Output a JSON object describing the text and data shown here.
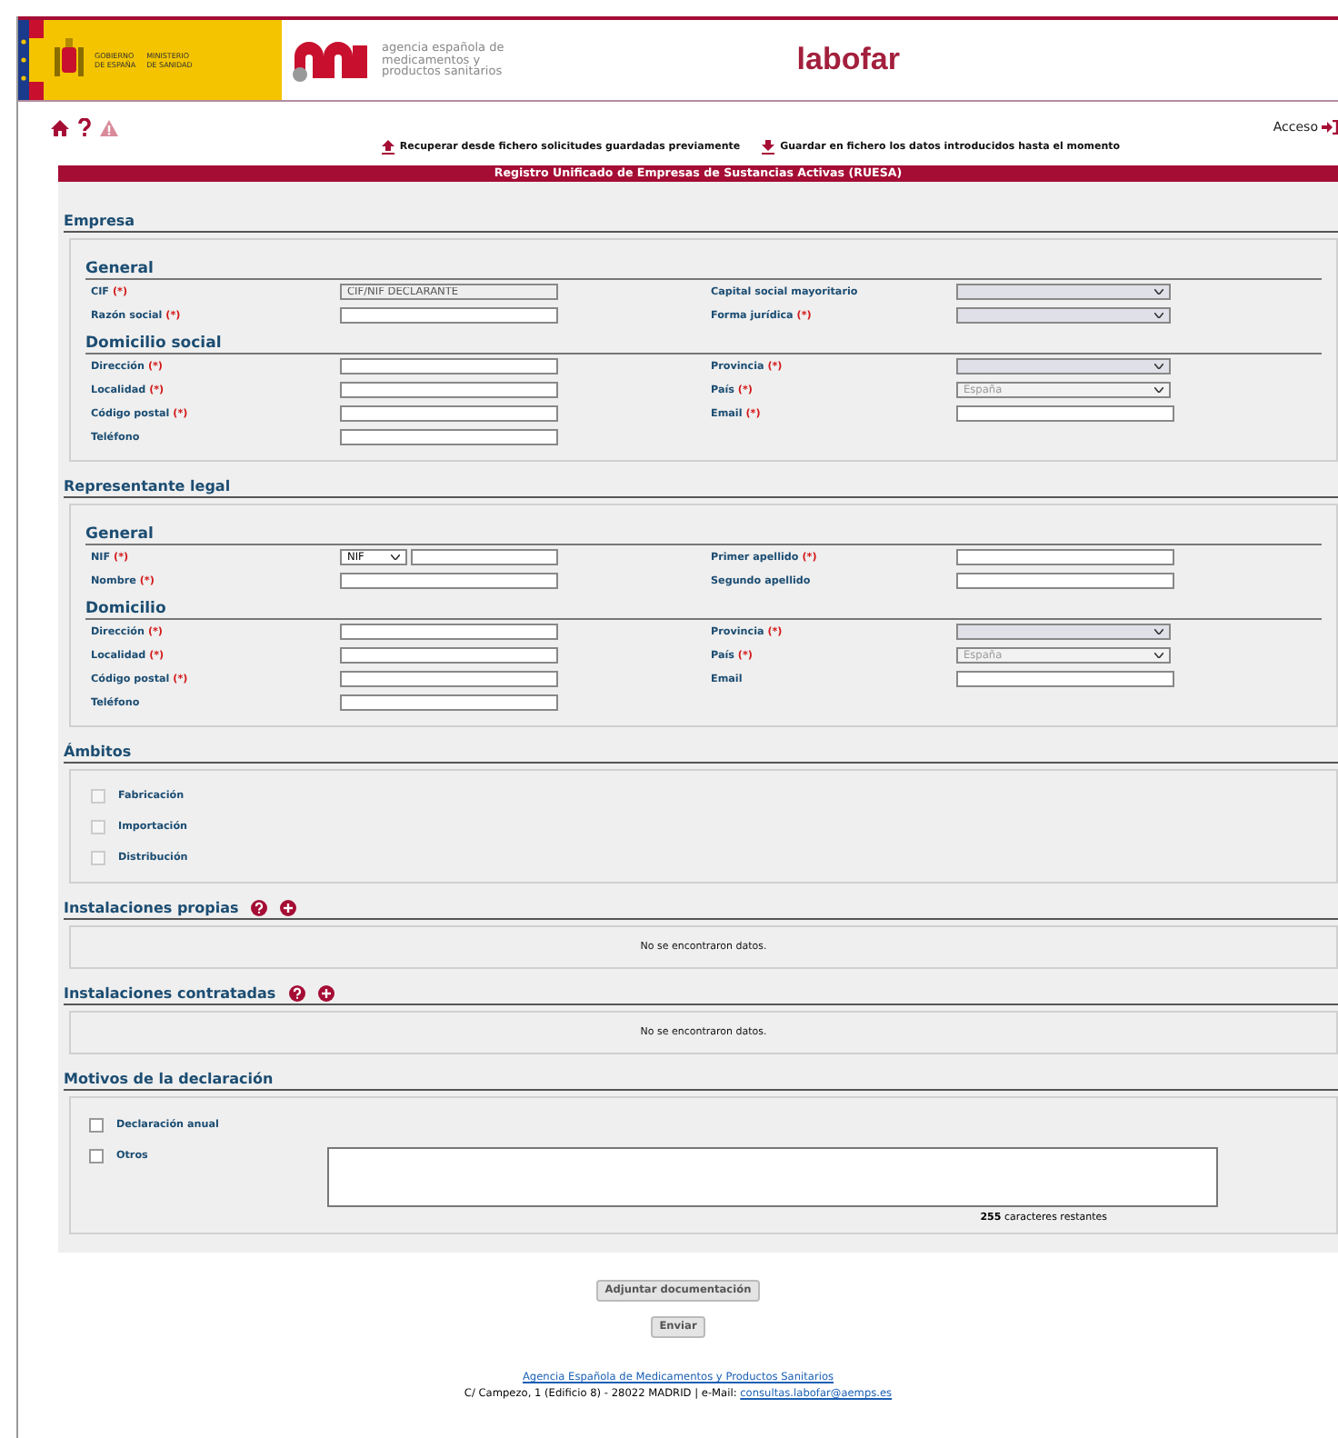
{
  "header": {
    "government": [
      "GOBIERNO",
      "DE ESPAÑA"
    ],
    "ministry": [
      "MINISTERIO",
      "DE SANIDAD"
    ],
    "agency": [
      "agencia española de",
      "medicamentos y",
      "productos sanitarios"
    ],
    "brand": "labofar"
  },
  "toolbar": {
    "access": "Acceso"
  },
  "file_actions": [
    {
      "kind": "upload",
      "label": "Recuperar desde fichero solicitudes guardadas previamente"
    },
    {
      "kind": "download",
      "label": "Guardar en fichero los datos introducidos hasta el momento"
    }
  ],
  "title": "Registro Unificado de Empresas de Sustancias Activas (RUESA)",
  "sections": [
    {
      "kind": "form",
      "title": "Empresa",
      "groups": [
        {
          "title": "General",
          "fields": [
            {
              "label": "CIF",
              "mark": "(*)",
              "kind": "text",
              "value": "CIF/NIF DECLARANTE",
              "disabled": true
            },
            {
              "label": "Capital social mayoritario",
              "kind": "select",
              "disabled": false
            },
            {
              "label": "Razón social",
              "mark": "(*)",
              "kind": "text",
              "disabled": false
            },
            {
              "label": "Forma jurídica",
              "mark": "(*)",
              "kind": "select",
              "disabled": false
            }
          ]
        },
        {
          "title": "Domicilio social",
          "fields": [
            {
              "label": "Dirección",
              "mark": "(*)",
              "kind": "text",
              "disabled": false
            },
            {
              "label": "Provincia",
              "mark": "(*)",
              "kind": "select",
              "disabled": false
            },
            {
              "label": "Localidad",
              "mark": "(*)",
              "kind": "text",
              "disabled": false
            },
            {
              "label": "País",
              "mark": "(*)",
              "kind": "select",
              "value": "España",
              "disabled": true
            },
            {
              "label": "Código postal",
              "mark": "(*)",
              "kind": "text",
              "disabled": false
            },
            {
              "label": "Email",
              "mark": "(*)",
              "kind": "text",
              "disabled": false
            },
            {
              "label": "Teléfono",
              "kind": "text",
              "disabled": false
            }
          ]
        }
      ]
    },
    {
      "kind": "form",
      "title": "Representante legal",
      "groups": [
        {
          "title": "General",
          "fields": [
            {
              "label": "NIF",
              "mark": "(*)",
              "kind": "document",
              "doc_type": "NIF",
              "disabled": false
            },
            {
              "label": "Primer apellido",
              "mark": "(*)",
              "kind": "text",
              "disabled": false
            },
            {
              "label": "Nombre",
              "mark": "(*)",
              "kind": "text",
              "disabled": false
            },
            {
              "label": "Segundo apellido",
              "kind": "text",
              "disabled": false
            }
          ]
        },
        {
          "title": "Domicilio",
          "fields": [
            {
              "label": "Dirección",
              "mark": "(*)",
              "kind": "text",
              "disabled": false
            },
            {
              "label": "Provincia",
              "mark": "(*)",
              "kind": "select",
              "disabled": false
            },
            {
              "label": "Localidad",
              "mark": "(*)",
              "kind": "text",
              "disabled": false
            },
            {
              "label": "País",
              "mark": "(*)",
              "kind": "select",
              "value": "España",
              "disabled": true
            },
            {
              "label": "Código postal",
              "mark": "(*)",
              "kind": "text",
              "disabled": false
            },
            {
              "label": "Email",
              "kind": "text",
              "disabled": false
            },
            {
              "label": "Teléfono",
              "kind": "text",
              "disabled": false
            }
          ]
        }
      ]
    },
    {
      "kind": "checklist",
      "title": "Ámbitos",
      "items": [
        {
          "label": "Fabricación",
          "checked": false,
          "disabled": true
        },
        {
          "label": "Importación",
          "checked": false,
          "disabled": true
        },
        {
          "label": "Distribución",
          "checked": false,
          "disabled": true
        }
      ]
    },
    {
      "kind": "table",
      "title": "Instalaciones propias",
      "help": true,
      "add": true,
      "empty": "No se encontraron datos."
    },
    {
      "kind": "table",
      "title": "Instalaciones contratadas",
      "help": true,
      "add": true,
      "empty": "No se encontraron datos."
    },
    {
      "kind": "reasons",
      "title": "Motivos de la declaración",
      "items": [
        {
          "label": "Declaración anual",
          "checked": false
        },
        {
          "label": "Otros",
          "checked": false,
          "kind": "textarea",
          "counter": "255",
          "counter_text": "caracteres restantes"
        }
      ]
    }
  ],
  "buttons": [
    "Adjuntar documentación",
    "Enviar"
  ],
  "footer": {
    "link": "Agencia Española de Medicamentos y Productos Sanitarios",
    "address": "C/ Campezo, 1 (Edificio 8) - 28022 MADRID | e-Mail:",
    "email": "consultas.labofar@aemps.es"
  }
}
